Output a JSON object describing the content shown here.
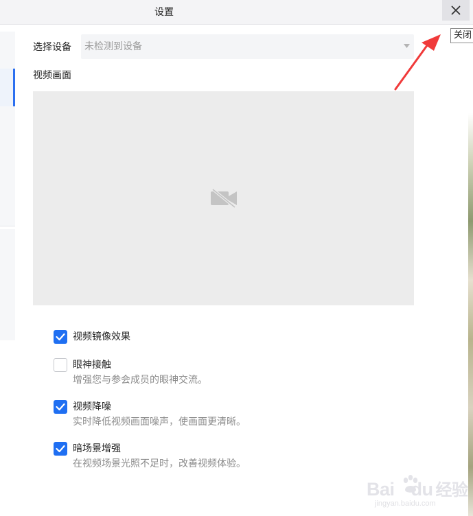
{
  "window": {
    "title": "设置",
    "close_tooltip": "关闭"
  },
  "icons": {
    "close": "close-icon",
    "dropdown": "chevron-down-icon",
    "camera_off": "video-off-icon",
    "check": "check-icon"
  },
  "colors": {
    "accent": "#1f6ff2",
    "annotation_arrow": "#f03a3a"
  },
  "device": {
    "label": "选择设备",
    "selected": "未检测到设备"
  },
  "preview": {
    "label": "视频画面"
  },
  "options": [
    {
      "label": "视频镜像效果",
      "checked": true,
      "description": ""
    },
    {
      "label": "眼神接触",
      "checked": false,
      "description": "增强您与参会成员的眼神交流。"
    },
    {
      "label": "视频降噪",
      "checked": true,
      "description": "实时降低视频画面噪声，使画面更清晰。"
    },
    {
      "label": "暗场景增强",
      "checked": true,
      "description": "在视频场景光照不足时，改善视频体验。"
    }
  ],
  "watermark": {
    "brand_left": "Bai",
    "brand_right": "du",
    "cn": "经验",
    "url": "jingyan.baidu.com"
  }
}
